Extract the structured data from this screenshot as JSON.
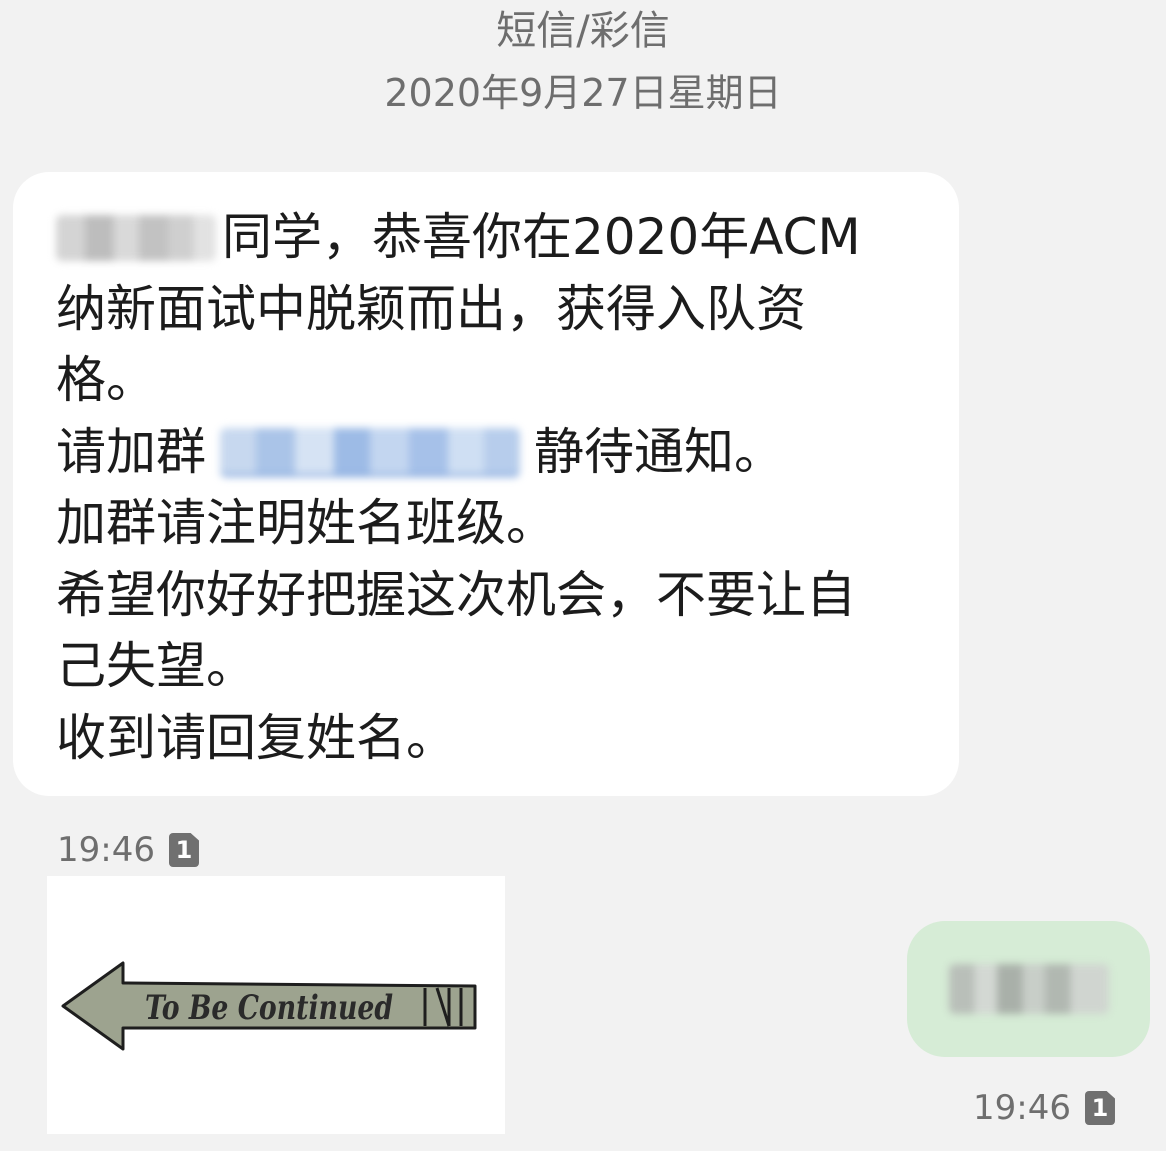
{
  "header": {
    "message_type": "短信/彩信",
    "date": "2020年9月27日星期日"
  },
  "incoming": {
    "lines": {
      "l1_after_name": "同学，恭喜你在2020年ACM",
      "l2": "纳新面试中脱颖而出，获得入队资",
      "l3": "格。",
      "l4_before_group": "请加群",
      "l4_after_group": "静待通知。",
      "l5": "加群请注明姓名班级。",
      "l6": "希望你好好把握这次机会，不要让自",
      "l7": "己失望。",
      "l8": "收到请回复姓名。"
    },
    "time": "19:46",
    "sim": "1",
    "image": {
      "sign_text": "To Be Continued"
    }
  },
  "outgoing": {
    "time": "19:46",
    "sim": "1"
  },
  "colors": {
    "background": "#f2f2f2",
    "incoming_bubble": "#ffffff",
    "outgoing_bubble": "#d6ecd6",
    "meta_text": "#6e6e6e",
    "arrow_fill": "#9da38f"
  }
}
